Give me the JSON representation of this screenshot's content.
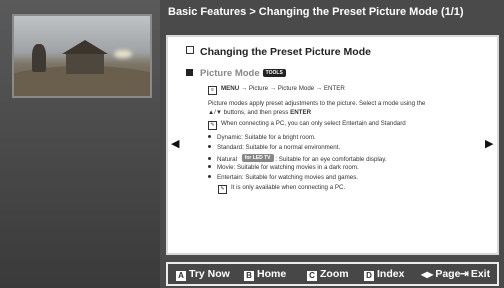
{
  "header": {
    "breadcrumb": "Basic Features > Changing the Preset Picture Mode (1/1)"
  },
  "nav": {
    "prev_glyph": "◀",
    "next_glyph": "▶"
  },
  "content": {
    "title": "Changing the Preset Picture Mode",
    "section": "Picture Mode",
    "section_tag": "TOOLS",
    "menu_path_prefix": "MENU",
    "menu_path": "→ Picture → Picture Mode → ENTER",
    "desc1": "Picture modes apply preset adjustments to the picture. Select a mode using the",
    "desc2_prefix": "▲/▼ buttons, and then press ",
    "desc2_bold": "ENTER",
    "note1": "When connecting a PC, you can only select Entertain and Standard",
    "bullets": [
      "Dynamic: Suitable for a bright room.",
      "Standard: Suitable for a normal environment.",
      "Natural",
      "Movie: Suitable for watching movies in a dark room.",
      "Entertain: Suitable for watching movies and games."
    ],
    "natural_tag": "for LED TV",
    "natural_suffix": ": Suitable for an eye comfortable display.",
    "note2": "It is only available when connecting a PC."
  },
  "footer": {
    "try_key": "A",
    "try_label": "Try Now",
    "home_key": "B",
    "home_label": "Home",
    "zoom_key": "C",
    "zoom_label": "Zoom",
    "index_key": "D",
    "index_label": "Index",
    "page_glyph": "◀▶",
    "page_label": "Page",
    "exit_glyph": "⇥",
    "exit_label": "Exit"
  }
}
